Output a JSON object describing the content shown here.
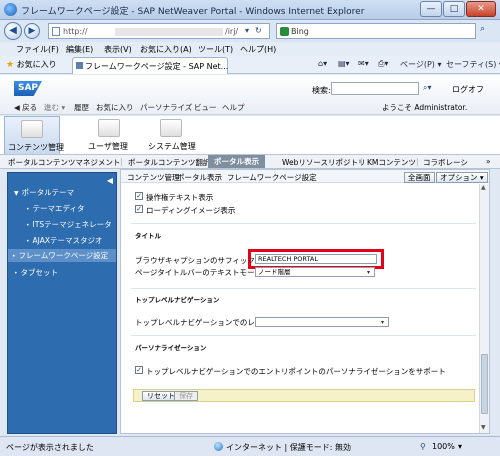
{
  "window": {
    "title": "フレームワークページ設定 - SAP NetWeaver Portal - Windows Internet Explorer",
    "minimize": "—",
    "maximize": "□",
    "close": "✕"
  },
  "address": {
    "url_start": "http://",
    "url_end": "/irj/",
    "search_engine": "Bing"
  },
  "menu": [
    "ファイル(F)",
    "編集(E)",
    "表示(V)",
    "お気に入り(A)",
    "ツール(T)",
    "ヘルプ(H)"
  ],
  "favorites": {
    "label": "お気に入り",
    "tab_title": "フレームワークページ設定 - SAP Net...",
    "page_menu": "ページ(P) ▾",
    "safety_menu": "セーフティ(S) ▾"
  },
  "sap": {
    "logo": "SAP",
    "nav": [
      "◀ 戻る",
      "進む ▾",
      "履歴",
      "お気に入り",
      "パーソナライズ",
      "ビュー",
      "ヘルプ"
    ],
    "search_label": "検索:",
    "logoff": "ログオフ",
    "welcome": "ようこそ Administrator."
  },
  "top_nav": [
    "コンテンツ管理",
    "ユーザ管理",
    "システム管理"
  ],
  "second_nav": [
    "ポータルコンテンツマネジメント",
    "ポータルコンテンツ翻訳",
    "ポータル表示",
    "Webリソースリポジトリ",
    "KMコンテンツ",
    "コラボレーシ"
  ],
  "second_nav_more": "»",
  "left_nav": {
    "collapse": "◀",
    "items": [
      {
        "label": "ポータルテーマ",
        "level": 0
      },
      {
        "label": "テーマエディタ",
        "level": 1
      },
      {
        "label": "ITSテーマジェネレータ",
        "level": 1
      },
      {
        "label": "AJAXテーマスタジオ",
        "level": 1
      },
      {
        "label": "フレームワークページ設定",
        "level": 0
      },
      {
        "label": "タブセット",
        "level": 0
      }
    ]
  },
  "content": {
    "breadcrumb": [
      "コンテンツ管理",
      "ポータル表示",
      "フレームワークページ設定"
    ],
    "fullscreen": "全画面",
    "options": "オプション ▾",
    "cb_status_text": "操作権テキスト表示",
    "cb_loading_image": "ローディングイメージ表示",
    "section_title": "タイトル",
    "browser_suffix_label": "ブラウザキャプションのサフィックス",
    "browser_suffix_value": "REALTECH PORTAL",
    "page_title_mode_label": "ページタイトルバーのテキストモード:",
    "page_title_mode_value": "ノード階層",
    "section_top_nav": "トップレベルナビゲーション",
    "top_nav_levels_label": "トップレベルナビゲーションでのレベル数:",
    "section_personalize": "パーソナライゼーション",
    "cb_personalize": "トップレベルナビゲーションでのエントリポイントのパーソナライゼーションをサポート",
    "reset": "リセット",
    "save": "保存"
  },
  "status": {
    "left": "ページが表示されました",
    "zone": "インターネット | 保護モード: 無効",
    "zoom": "100%"
  }
}
